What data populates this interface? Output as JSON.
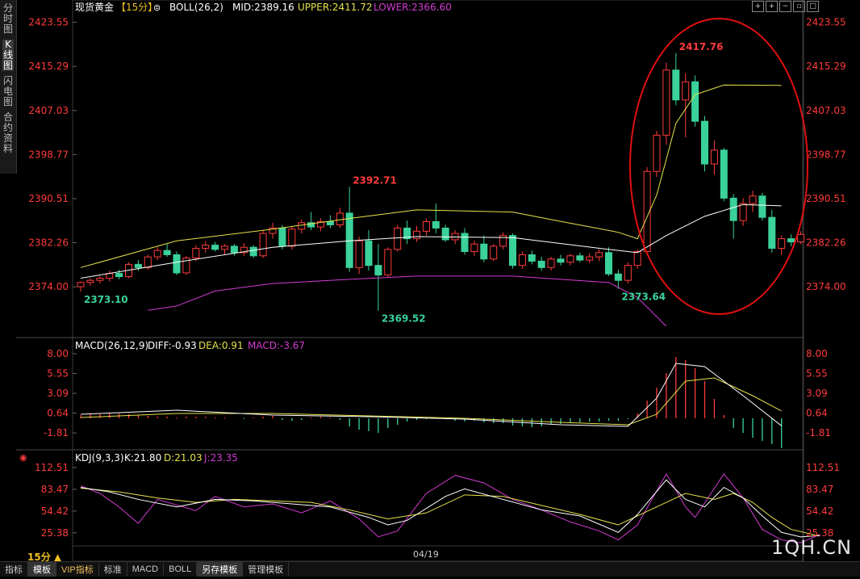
{
  "side_tabs": [
    "分时图",
    "K线图",
    "闪电图",
    "合约资料"
  ],
  "side_active": 1,
  "header": {
    "title": "现货黄金",
    "period": "【15分】",
    "boll": "BOLL(26,2)",
    "mid": "MID:2389.16",
    "upper": "UPPER:2411.72",
    "lower": "LOWER:2366.60"
  },
  "macd_header": {
    "name": "MACD(26,12,9)",
    "diff": "DIFF:-0.93",
    "dea": "DEA:0.91",
    "macd": "MACD:-3.67"
  },
  "kdj_header": {
    "name": "KDJ(9,3,3)",
    "k": "K:21.80",
    "d": "D:21.03",
    "j": "J:23.35"
  },
  "bottom_tabs": [
    "指标",
    "模板",
    "VIP指标",
    "标准",
    "MACD",
    "BOLL",
    "另存模板",
    "管理模板"
  ],
  "period_label": "15分 ▲",
  "date_label": "04/19",
  "watermark": "1QH.CN",
  "colors": {
    "up": "#ff3b3b",
    "down": "#3ad29a",
    "mid": "#ffffff",
    "upper": "#e6e24a",
    "lower": "#d23bd2",
    "axis_text": "#ff3b3b",
    "circle": "#e01010"
  },
  "chart_data": [
    {
      "type": "candlestick",
      "title": "现货黄金 15分",
      "y_ticks": [
        2374.0,
        2382.26,
        2390.51,
        2398.77,
        2407.03,
        2415.29,
        2423.55
      ],
      "ylim": [
        2366.0,
        2425.0
      ],
      "annotations": [
        {
          "label": "2392.71",
          "index": 28,
          "value": 2392.71
        },
        {
          "label": "2417.76",
          "index": 62,
          "value": 2417.76
        },
        {
          "label": "2373.10",
          "index": 0,
          "value": 2373.1
        },
        {
          "label": "2369.52",
          "index": 31,
          "value": 2369.52
        },
        {
          "label": "2373.64",
          "index": 56,
          "value": 2373.64
        }
      ],
      "candles": [
        [
          2374.0,
          2375.0,
          2373.1,
          2374.8
        ],
        [
          2374.8,
          2375.6,
          2374.2,
          2375.2
        ],
        [
          2375.2,
          2376.0,
          2374.6,
          2375.6
        ],
        [
          2375.6,
          2377.0,
          2375.0,
          2376.5
        ],
        [
          2376.5,
          2377.2,
          2375.4,
          2375.9
        ],
        [
          2375.9,
          2378.6,
          2375.6,
          2378.2
        ],
        [
          2378.2,
          2379.0,
          2377.0,
          2377.6
        ],
        [
          2377.6,
          2380.0,
          2377.2,
          2379.6
        ],
        [
          2379.6,
          2381.4,
          2379.0,
          2380.8
        ],
        [
          2380.8,
          2382.0,
          2379.6,
          2380.0
        ],
        [
          2380.0,
          2380.6,
          2376.2,
          2376.6
        ],
        [
          2376.6,
          2379.8,
          2376.2,
          2379.4
        ],
        [
          2379.4,
          2381.8,
          2378.8,
          2381.2
        ],
        [
          2381.2,
          2382.6,
          2380.4,
          2381.8
        ],
        [
          2381.8,
          2382.4,
          2380.6,
          2381.0
        ],
        [
          2381.0,
          2382.0,
          2380.0,
          2381.6
        ],
        [
          2381.6,
          2382.0,
          2379.8,
          2380.4
        ],
        [
          2380.4,
          2382.2,
          2379.8,
          2381.4
        ],
        [
          2381.4,
          2381.8,
          2379.4,
          2379.8
        ],
        [
          2379.8,
          2384.6,
          2379.4,
          2384.0
        ],
        [
          2384.0,
          2386.0,
          2383.0,
          2385.0
        ],
        [
          2385.0,
          2385.6,
          2381.0,
          2381.6
        ],
        [
          2381.6,
          2385.4,
          2381.0,
          2384.8
        ],
        [
          2384.8,
          2386.6,
          2384.0,
          2386.0
        ],
        [
          2386.0,
          2388.0,
          2384.6,
          2385.2
        ],
        [
          2385.2,
          2386.8,
          2384.4,
          2386.2
        ],
        [
          2386.2,
          2387.4,
          2385.0,
          2385.6
        ],
        [
          2385.6,
          2388.8,
          2385.0,
          2387.8
        ],
        [
          2387.8,
          2392.71,
          2376.8,
          2377.6
        ],
        [
          2377.6,
          2383.4,
          2376.4,
          2382.6
        ],
        [
          2382.6,
          2384.6,
          2377.0,
          2378.0
        ],
        [
          2378.0,
          2382.0,
          2369.52,
          2376.2
        ],
        [
          2376.2,
          2381.4,
          2375.8,
          2381.0
        ],
        [
          2381.0,
          2385.6,
          2380.6,
          2385.0
        ],
        [
          2385.0,
          2386.4,
          2382.0,
          2383.0
        ],
        [
          2383.0,
          2385.4,
          2382.4,
          2384.4
        ],
        [
          2384.4,
          2386.8,
          2383.6,
          2386.2
        ],
        [
          2386.2,
          2389.6,
          2384.0,
          2385.0
        ],
        [
          2385.0,
          2385.6,
          2382.4,
          2382.8
        ],
        [
          2382.8,
          2384.6,
          2382.0,
          2384.0
        ],
        [
          2384.0,
          2385.0,
          2380.0,
          2380.6
        ],
        [
          2380.6,
          2382.6,
          2379.8,
          2382.0
        ],
        [
          2382.0,
          2383.6,
          2378.6,
          2379.2
        ],
        [
          2379.2,
          2382.0,
          2378.8,
          2381.6
        ],
        [
          2381.6,
          2384.2,
          2381.0,
          2383.6
        ],
        [
          2383.6,
          2384.0,
          2377.4,
          2378.0
        ],
        [
          2378.0,
          2380.6,
          2377.4,
          2380.0
        ],
        [
          2380.0,
          2380.8,
          2378.2,
          2378.8
        ],
        [
          2378.8,
          2379.6,
          2377.0,
          2377.6
        ],
        [
          2377.6,
          2379.6,
          2377.0,
          2379.2
        ],
        [
          2379.2,
          2380.0,
          2378.0,
          2378.6
        ],
        [
          2378.6,
          2380.2,
          2378.0,
          2379.8
        ],
        [
          2379.8,
          2380.4,
          2378.6,
          2379.0
        ],
        [
          2379.0,
          2380.2,
          2378.4,
          2379.6
        ],
        [
          2379.6,
          2381.0,
          2378.8,
          2380.4
        ],
        [
          2380.4,
          2381.4,
          2376.0,
          2376.4
        ],
        [
          2376.4,
          2377.2,
          2373.64,
          2375.2
        ],
        [
          2375.2,
          2378.6,
          2374.6,
          2378.0
        ],
        [
          2378.0,
          2381.0,
          2377.4,
          2380.6
        ],
        [
          2380.6,
          2396.4,
          2380.0,
          2395.6
        ],
        [
          2395.6,
          2403.2,
          2394.6,
          2402.4
        ],
        [
          2402.4,
          2416.0,
          2400.6,
          2414.6
        ],
        [
          2414.6,
          2417.76,
          2408.0,
          2409.0
        ],
        [
          2409.0,
          2414.0,
          2402.0,
          2412.4
        ],
        [
          2412.4,
          2413.6,
          2404.0,
          2405.0
        ],
        [
          2405.0,
          2406.0,
          2395.6,
          2397.0
        ],
        [
          2397.0,
          2401.4,
          2395.0,
          2399.6
        ],
        [
          2399.6,
          2400.0,
          2390.0,
          2390.6
        ],
        [
          2390.6,
          2391.4,
          2383.0,
          2386.4
        ],
        [
          2386.4,
          2390.6,
          2385.4,
          2389.6
        ],
        [
          2389.6,
          2392.0,
          2388.0,
          2391.0
        ],
        [
          2391.0,
          2391.6,
          2386.4,
          2387.0
        ],
        [
          2387.0,
          2388.4,
          2380.4,
          2381.2
        ],
        [
          2381.2,
          2383.6,
          2380.0,
          2383.0
        ],
        [
          2383.0,
          2383.8,
          2381.6,
          2382.4
        ],
        [
          2382.4,
          2384.4,
          2382.0,
          2383.8
        ]
      ],
      "boll_mid": [
        [
          0,
          2375.6
        ],
        [
          10,
          2378.6
        ],
        [
          20,
          2381.4
        ],
        [
          28,
          2382.6
        ],
        [
          35,
          2383.4
        ],
        [
          45,
          2383.2
        ],
        [
          55,
          2381.0
        ],
        [
          58,
          2380.4
        ],
        [
          61,
          2383.6
        ],
        [
          65,
          2387.2
        ],
        [
          69,
          2389.4
        ],
        [
          73,
          2389.16
        ]
      ],
      "boll_upper": [
        [
          0,
          2377.6
        ],
        [
          10,
          2382.6
        ],
        [
          20,
          2384.8
        ],
        [
          28,
          2386.8
        ],
        [
          35,
          2388.4
        ],
        [
          45,
          2388.0
        ],
        [
          49,
          2386.6
        ],
        [
          56,
          2384.2
        ],
        [
          58,
          2383.0
        ],
        [
          60,
          2391.2
        ],
        [
          62,
          2404.6
        ],
        [
          64,
          2410.0
        ],
        [
          67,
          2411.8
        ],
        [
          73,
          2411.72
        ]
      ],
      "boll_lower": [
        [
          7,
          2369.6
        ],
        [
          10,
          2370.4
        ],
        [
          14,
          2373.2
        ],
        [
          20,
          2374.6
        ],
        [
          28,
          2375.4
        ],
        [
          35,
          2376.0
        ],
        [
          45,
          2376.0
        ],
        [
          55,
          2374.8
        ],
        [
          58,
          2372.0
        ],
        [
          61,
          2366.6
        ]
      ]
    },
    {
      "type": "macd",
      "title": "MACD(26,12,9)",
      "y_ticks": [
        -1.81,
        0.64,
        3.09,
        5.55,
        8.0
      ],
      "ylim": [
        -3.8,
        8.6
      ],
      "diff": [
        [
          0,
          0.5
        ],
        [
          10,
          1.0
        ],
        [
          20,
          0.4
        ],
        [
          30,
          0.2
        ],
        [
          40,
          -0.1
        ],
        [
          50,
          -0.8
        ],
        [
          57,
          -1.0
        ],
        [
          60,
          2.5
        ],
        [
          62,
          6.8
        ],
        [
          65,
          6.4
        ],
        [
          69,
          2.8
        ],
        [
          73,
          -0.93
        ]
      ],
      "dea": [
        [
          0,
          0.1
        ],
        [
          10,
          0.6
        ],
        [
          20,
          0.6
        ],
        [
          30,
          0.3
        ],
        [
          40,
          0.0
        ],
        [
          50,
          -0.5
        ],
        [
          57,
          -0.8
        ],
        [
          60,
          0.5
        ],
        [
          63,
          4.6
        ],
        [
          66,
          5.0
        ],
        [
          70,
          2.8
        ],
        [
          73,
          0.91
        ]
      ],
      "bars": [
        0.4,
        0.5,
        0.5,
        0.6,
        0.6,
        0.5,
        0.4,
        0.3,
        0.2,
        0.2,
        0.1,
        0.2,
        0.2,
        0.2,
        0.1,
        0.1,
        0.0,
        -0.1,
        0.1,
        0.2,
        0.3,
        -0.2,
        -0.3,
        -0.2,
        0.1,
        0.2,
        0.1,
        -0.2,
        -1.0,
        -1.4,
        -1.6,
        -1.8,
        -1.2,
        -0.8,
        -0.4,
        -0.2,
        -0.1,
        0.1,
        -0.1,
        -0.3,
        -0.4,
        -0.3,
        -0.5,
        -0.6,
        -0.6,
        -0.9,
        -1.0,
        -1.1,
        -1.0,
        -0.8,
        -0.7,
        -0.6,
        -0.5,
        -0.4,
        -0.4,
        -0.3,
        -0.3,
        -0.1,
        0.6,
        2.2,
        3.8,
        5.6,
        7.6,
        7.2,
        6.2,
        4.6,
        2.4,
        0.4,
        -1.2,
        -1.8,
        -2.4,
        -2.8,
        -3.2,
        -3.67
      ]
    },
    {
      "type": "kdj",
      "title": "KDJ(9,3,3)",
      "y_ticks": [
        25.38,
        54.42,
        83.47,
        112.51
      ],
      "ylim": [
        8,
        120
      ],
      "k": [
        [
          0,
          86
        ],
        [
          3,
          80
        ],
        [
          6,
          70
        ],
        [
          10,
          60
        ],
        [
          14,
          70
        ],
        [
          18,
          68
        ],
        [
          22,
          64
        ],
        [
          26,
          60
        ],
        [
          30,
          46
        ],
        [
          32,
          36
        ],
        [
          34,
          42
        ],
        [
          38,
          74
        ],
        [
          40,
          84
        ],
        [
          44,
          70
        ],
        [
          48,
          56
        ],
        [
          52,
          48
        ],
        [
          56,
          26
        ],
        [
          58,
          50
        ],
        [
          61,
          96
        ],
        [
          63,
          70
        ],
        [
          65,
          60
        ],
        [
          67,
          86
        ],
        [
          69,
          72
        ],
        [
          71,
          48
        ],
        [
          73,
          26
        ],
        [
          75,
          20
        ],
        [
          77,
          21.8
        ]
      ],
      "d": [
        [
          0,
          85
        ],
        [
          4,
          80
        ],
        [
          8,
          72
        ],
        [
          12,
          66
        ],
        [
          16,
          70
        ],
        [
          20,
          68
        ],
        [
          24,
          66
        ],
        [
          28,
          56
        ],
        [
          32,
          44
        ],
        [
          36,
          52
        ],
        [
          40,
          76
        ],
        [
          44,
          74
        ],
        [
          48,
          62
        ],
        [
          52,
          50
        ],
        [
          56,
          36
        ],
        [
          60,
          60
        ],
        [
          63,
          78
        ],
        [
          66,
          70
        ],
        [
          68,
          78
        ],
        [
          70,
          66
        ],
        [
          72,
          46
        ],
        [
          74,
          30
        ],
        [
          77,
          21.03
        ]
      ],
      "j": [
        [
          0,
          88
        ],
        [
          2,
          78
        ],
        [
          4,
          60
        ],
        [
          6,
          38
        ],
        [
          8,
          70
        ],
        [
          12,
          55
        ],
        [
          14,
          74
        ],
        [
          17,
          60
        ],
        [
          20,
          64
        ],
        [
          23,
          52
        ],
        [
          26,
          68
        ],
        [
          29,
          44
        ],
        [
          31,
          20
        ],
        [
          33,
          28
        ],
        [
          36,
          78
        ],
        [
          39,
          102
        ],
        [
          42,
          92
        ],
        [
          45,
          70
        ],
        [
          48,
          56
        ],
        [
          51,
          40
        ],
        [
          54,
          28
        ],
        [
          56,
          16
        ],
        [
          58,
          36
        ],
        [
          61,
          104
        ],
        [
          63,
          60
        ],
        [
          64,
          46
        ],
        [
          67,
          104
        ],
        [
          69,
          72
        ],
        [
          71,
          30
        ],
        [
          73,
          16
        ],
        [
          75,
          12
        ],
        [
          77,
          23.35
        ]
      ]
    }
  ]
}
